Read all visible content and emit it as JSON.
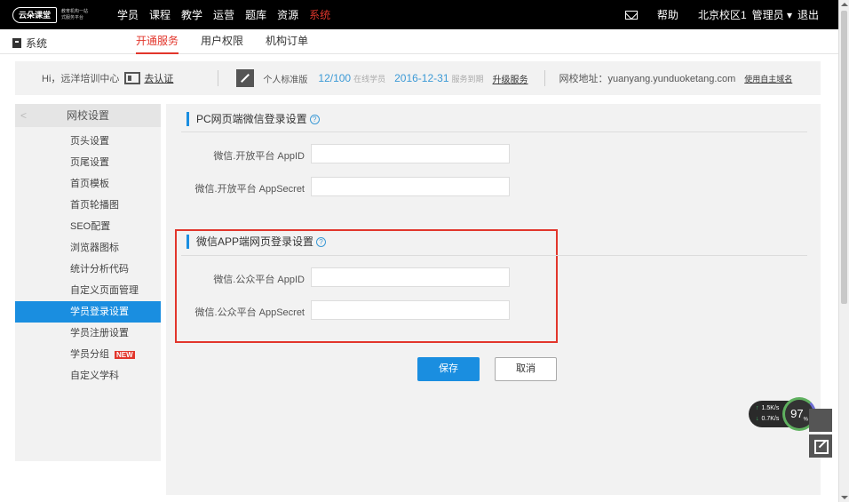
{
  "topbar": {
    "logo_text": "云朵课堂",
    "logo_sub": "教育机构一站式服务平台",
    "nav": [
      "学员",
      "课程",
      "教学",
      "运营",
      "题库",
      "资源",
      "系统"
    ],
    "active_nav": "系统",
    "help": "帮助",
    "campus": "北京校区1",
    "admin": "管理员 ▾",
    "logout": "退出"
  },
  "subnav": {
    "system_label": "系统",
    "tabs": [
      "开通服务",
      "用户权限",
      "机构订单"
    ]
  },
  "infobar": {
    "greeting": "Hi，远洋培训中心",
    "verify_link": "去认证",
    "edition": "个人标准版",
    "students": "12/100",
    "students_label": "在线学员",
    "expiry": "2016-12-31",
    "expiry_label": "服务到期",
    "upgrade": "升级服务",
    "url_label": "网校地址：yuanyang.yunduoketang.com",
    "custom_domain": "使用自主域名"
  },
  "sidebar": {
    "header": "网校设置",
    "items": [
      "页头设置",
      "页尾设置",
      "首页模板",
      "首页轮播图",
      "SEO配置",
      "浏览器图标",
      "统计分析代码",
      "自定义页面管理",
      "学员登录设置",
      "学员注册设置",
      "学员分组",
      "自定义学科"
    ],
    "new_badge": "NEW"
  },
  "main": {
    "section1_title": "PC网页端微信登录设置",
    "s1_appid_label": "微信.开放平台 AppID",
    "s1_secret_label": "微信.开放平台 AppSecret",
    "section2_title": "微信APP端网页登录设置",
    "s2_appid_label": "微信.公众平台 AppID",
    "s2_secret_label": "微信.公众平台 AppSecret",
    "save": "保存",
    "cancel": "取消"
  },
  "widget": {
    "up_speed": "1.5K/s",
    "down_speed": "0.7K/s",
    "percent": "97",
    "percent_unit": "%"
  }
}
